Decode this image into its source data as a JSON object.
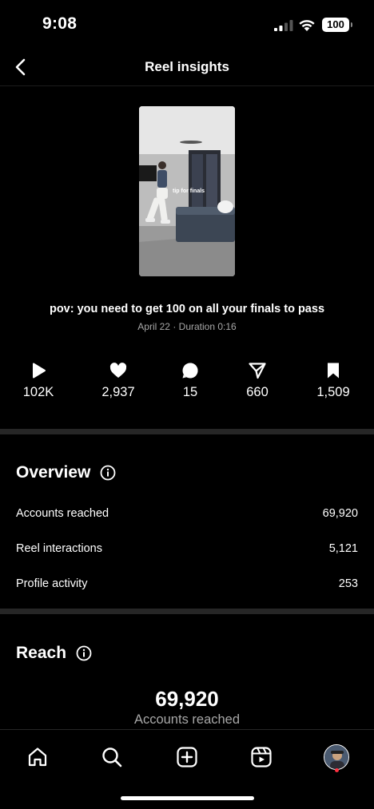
{
  "status_bar": {
    "time": "9:08",
    "battery": "100"
  },
  "nav": {
    "title": "Reel insights"
  },
  "reel": {
    "thumbnail_overlay_text": "tip for finals",
    "caption": "pov: you need to get 100 on all your finals to pass",
    "meta": "April 22 · Duration 0:16"
  },
  "stats": [
    {
      "icon": "play-icon",
      "value": "102K"
    },
    {
      "icon": "heart-icon",
      "value": "2,937"
    },
    {
      "icon": "comment-icon",
      "value": "15"
    },
    {
      "icon": "share-icon",
      "value": "660"
    },
    {
      "icon": "bookmark-icon",
      "value": "1,509"
    }
  ],
  "overview": {
    "title": "Overview",
    "rows": [
      {
        "label": "Accounts reached",
        "value": "69,920"
      },
      {
        "label": "Reel interactions",
        "value": "5,121"
      },
      {
        "label": "Profile activity",
        "value": "253"
      }
    ]
  },
  "reach": {
    "title": "Reach",
    "number": "69,920",
    "label": "Accounts reached"
  },
  "tabbar": [
    "home-icon",
    "search-icon",
    "create-icon",
    "reels-icon",
    "profile-avatar"
  ],
  "colors": {
    "background": "#000000",
    "divider": "#262626",
    "secondary_text": "#a8a8a8",
    "notification": "#ff3040"
  }
}
